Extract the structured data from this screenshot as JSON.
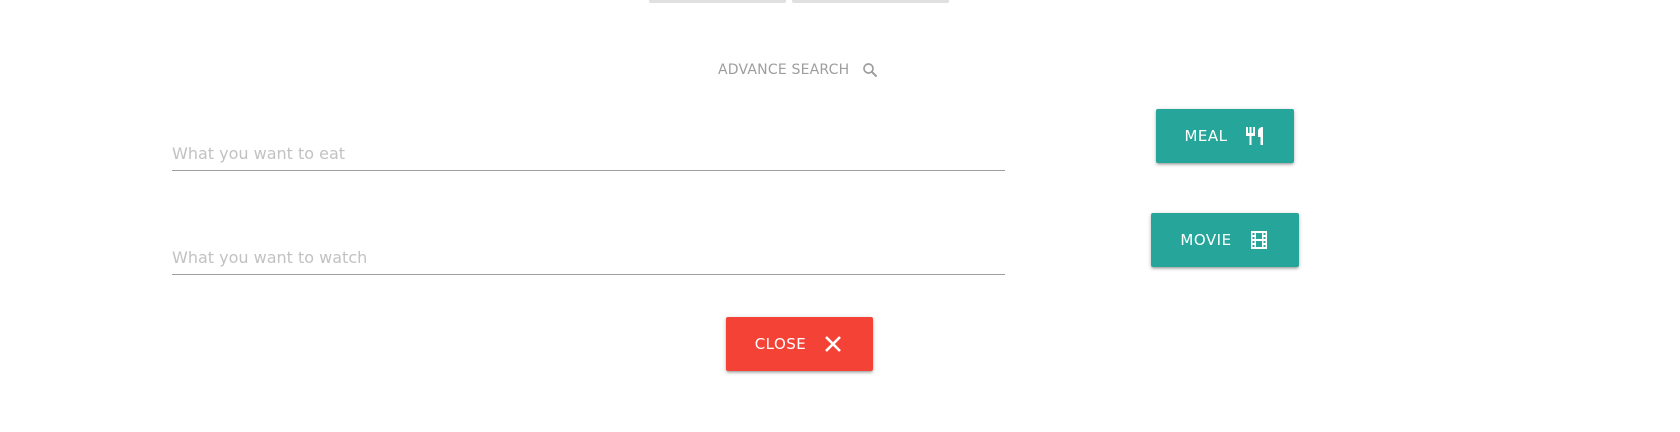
{
  "colors": {
    "accent_teal": "#26a69a",
    "danger_red": "#f44336",
    "muted_text": "#9e9e9e"
  },
  "advance_search": {
    "title": "ADVANCE SEARCH",
    "icon": "search-icon"
  },
  "fields": {
    "eat": {
      "placeholder": "What you want to eat",
      "value": ""
    },
    "watch": {
      "placeholder": "What you want to watch",
      "value": ""
    }
  },
  "buttons": {
    "meal": {
      "label": "MEAL",
      "icon": "utensils-icon"
    },
    "movie": {
      "label": "MOVIE",
      "icon": "film-icon"
    },
    "close": {
      "label": "CLOSE",
      "icon": "close-icon"
    }
  }
}
